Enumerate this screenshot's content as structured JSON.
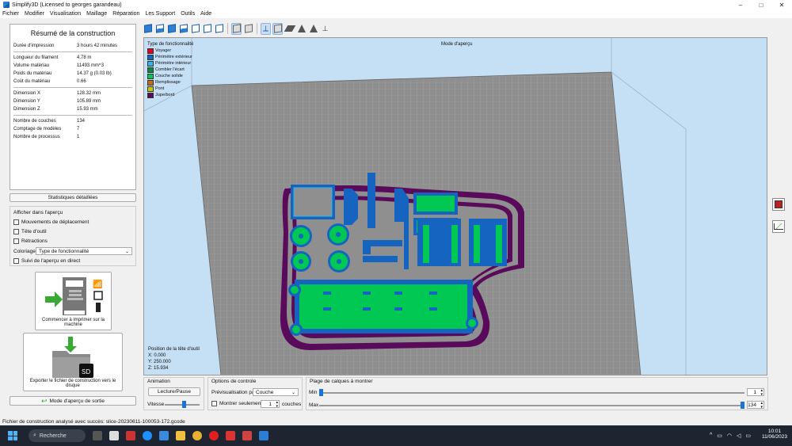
{
  "window": {
    "title": "Simplify3D (Licensed to georges garandeau)"
  },
  "menu": [
    "Fichier",
    "Modifier",
    "Visualisation",
    "Maillage",
    "Réparation",
    "Les Support",
    "Outils",
    "Aide"
  ],
  "summary": {
    "title": "Résumé de la construction",
    "rows": [
      {
        "k": "Durée d'impression",
        "v": "3 hours 42 minutes"
      },
      {
        "k": "Longueur du filament",
        "v": "4.78 m"
      },
      {
        "k": "Volume matériau",
        "v": "11493 mm^3"
      },
      {
        "k": "Poids du matériau",
        "v": "14.37 g (0.03 lb)"
      },
      {
        "k": "Coût du matériau",
        "v": "0.66"
      },
      {
        "k": "Dimension X",
        "v": "128.32 mm"
      },
      {
        "k": "Dimension Y",
        "v": "105.89 mm"
      },
      {
        "k": "Dimension Z",
        "v": "15.93 mm"
      },
      {
        "k": "Nombre de couches",
        "v": "134"
      },
      {
        "k": "Comptage de modèles",
        "v": "7"
      },
      {
        "k": "Nombre de processus",
        "v": "1"
      }
    ],
    "details_button": "Statistiques détaillées"
  },
  "preview": {
    "title": "Afficher dans l'aperçu",
    "checks": [
      "Mouvements de déplacement",
      "Tête d'outil",
      "Rétractions"
    ],
    "coloring_label": "Coloriage",
    "coloring_value": "Type de fonctionnalité",
    "live_check": "Suivi de l'aperçu en direct"
  },
  "actions": {
    "print": "Commencer à imprimer sur la machine",
    "export": "Exporter le fichier de construction vers le disque",
    "exit": "Mode d'aperçu de sortie"
  },
  "viewport": {
    "mode_label": "Mode d'aperçu",
    "legend_title": "Type de fonctionnalité",
    "legend": [
      {
        "name": "Voyager",
        "color": "#e3001b"
      },
      {
        "name": "Périmètre extérieur",
        "color": "#1565c0"
      },
      {
        "name": "Périmètre intérieur",
        "color": "#30b7e8"
      },
      {
        "name": "Combler l'écart",
        "color": "#0a8a3a"
      },
      {
        "name": "Couche solide",
        "color": "#00c853"
      },
      {
        "name": "Remplissage",
        "color": "#c46a1a"
      },
      {
        "name": "Pont",
        "color": "#c8c800"
      },
      {
        "name": "Jupe/bord",
        "color": "#5a0a5a"
      }
    ],
    "toolhead": {
      "title": "Position de la tête d'outil",
      "x": "X: 0.000",
      "y": "Y: 250.000",
      "z": "Z: 15.934"
    }
  },
  "animation": {
    "title": "Animation",
    "play": "Lecture/Pause",
    "speed": "Vitesse"
  },
  "controls": {
    "title": "Options de controle",
    "preview_by": "Prévisualisation par",
    "preview_by_value": "Couche",
    "show_only": "Montrer seulement",
    "show_only_value": "1",
    "layers": "couches"
  },
  "range": {
    "title": "Plage de calques à montrer",
    "min_label": "Min",
    "min_value": "1",
    "max_label": "Max",
    "max_value": "134"
  },
  "status": "Fichier de construction analysé avec succès: slice-20230611-100053-172.gcode",
  "taskbar": {
    "search": "Recherche",
    "time": "10:01",
    "date": "11/06/2023"
  }
}
